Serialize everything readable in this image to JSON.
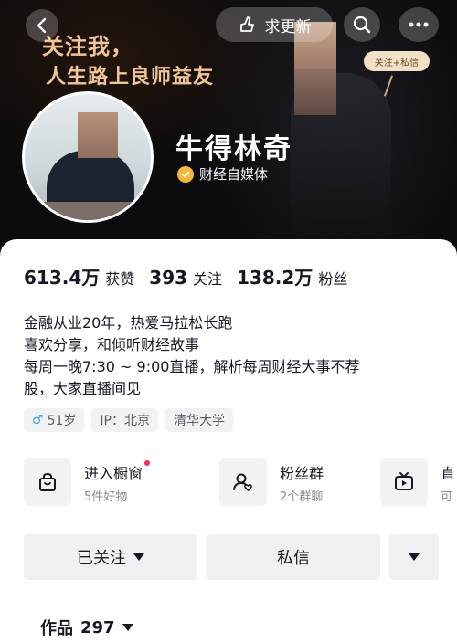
{
  "header": {
    "slogan_line1": "关注我，",
    "slogan_line2": "人生路上良师益友",
    "promo_tag": "关注+私信",
    "seek_label": "求更新",
    "icons": {
      "back": "chevron-left-icon",
      "seek": "hand-point-icon",
      "search": "search-icon",
      "more": "more-dots-icon"
    }
  },
  "profile": {
    "name": "牛得林奇",
    "verified_label": "财经自媒体",
    "verified_color": "#f5b93a"
  },
  "stats": [
    {
      "value": "613.4万",
      "label": "获赞"
    },
    {
      "value": "393",
      "label": "关注"
    },
    {
      "value": "138.2万",
      "label": "粉丝"
    }
  ],
  "bio": [
    "金融从业20年，热爱马拉松长跑",
    "喜欢分享，和倾听财经故事",
    "每周一晚7:30 ~ 9:00直播，解析每周财经大事不荐",
    "股，大家直播间见"
  ],
  "tags": {
    "gender_symbol": "♂",
    "age": "51岁",
    "ip": "IP：北京",
    "school": "清华大学"
  },
  "features": [
    {
      "title": "进入橱窗",
      "subtitle": "5件好物",
      "icon": "shopping-bag-icon",
      "has_dot": true
    },
    {
      "title": "粉丝群",
      "subtitle": "2个群聊",
      "icon": "fan-group-icon",
      "has_dot": false
    },
    {
      "title": "直",
      "subtitle": "可",
      "icon": "tv-icon",
      "has_dot": false
    }
  ],
  "actions": {
    "followed_label": "已关注",
    "message_label": "私信"
  },
  "works": {
    "label": "作品",
    "count": "297"
  },
  "colors": {
    "accent_red": "#fe2c55",
    "slogan_gold": "#f1c596",
    "gender_blue": "#3aa7e8"
  }
}
